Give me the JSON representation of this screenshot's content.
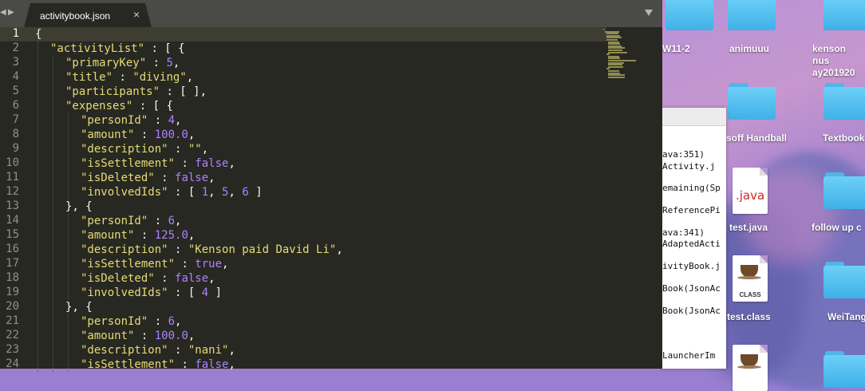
{
  "editor": {
    "tab_title": "activitybook.json",
    "nav_back": "◀",
    "nav_forward": "▶",
    "close_glyph": "×",
    "current_line": 1,
    "lines": [
      {
        "num": "1",
        "indent": 0,
        "t": [
          [
            "p",
            "{"
          ]
        ]
      },
      {
        "num": "2",
        "indent": 1,
        "t": [
          [
            "k",
            "\"activityList\""
          ],
          [
            "p",
            " : [ {"
          ]
        ]
      },
      {
        "num": "3",
        "indent": 2,
        "t": [
          [
            "k",
            "\"primaryKey\""
          ],
          [
            "p",
            " : "
          ],
          [
            "n",
            "5"
          ],
          [
            "p",
            ","
          ]
        ]
      },
      {
        "num": "4",
        "indent": 2,
        "t": [
          [
            "k",
            "\"title\""
          ],
          [
            "p",
            " : "
          ],
          [
            "k",
            "\"diving\""
          ],
          [
            "p",
            ","
          ]
        ]
      },
      {
        "num": "5",
        "indent": 2,
        "t": [
          [
            "k",
            "\"participants\""
          ],
          [
            "p",
            " : [ ],"
          ]
        ]
      },
      {
        "num": "6",
        "indent": 2,
        "t": [
          [
            "k",
            "\"expenses\""
          ],
          [
            "p",
            " : [ {"
          ]
        ]
      },
      {
        "num": "7",
        "indent": 3,
        "t": [
          [
            "k",
            "\"personId\""
          ],
          [
            "p",
            " : "
          ],
          [
            "n",
            "4"
          ],
          [
            "p",
            ","
          ]
        ]
      },
      {
        "num": "8",
        "indent": 3,
        "t": [
          [
            "k",
            "\"amount\""
          ],
          [
            "p",
            " : "
          ],
          [
            "n",
            "100.0"
          ],
          [
            "p",
            ","
          ]
        ]
      },
      {
        "num": "9",
        "indent": 3,
        "t": [
          [
            "k",
            "\"description\""
          ],
          [
            "p",
            " : "
          ],
          [
            "k",
            "\"\""
          ],
          [
            "p",
            ","
          ]
        ]
      },
      {
        "num": "10",
        "indent": 3,
        "t": [
          [
            "k",
            "\"isSettlement\""
          ],
          [
            "p",
            " : "
          ],
          [
            "n",
            "false"
          ],
          [
            "p",
            ","
          ]
        ]
      },
      {
        "num": "11",
        "indent": 3,
        "t": [
          [
            "k",
            "\"isDeleted\""
          ],
          [
            "p",
            " : "
          ],
          [
            "n",
            "false"
          ],
          [
            "p",
            ","
          ]
        ]
      },
      {
        "num": "12",
        "indent": 3,
        "t": [
          [
            "k",
            "\"involvedIds\""
          ],
          [
            "p",
            " : [ "
          ],
          [
            "n",
            "1"
          ],
          [
            "p",
            ", "
          ],
          [
            "n",
            "5"
          ],
          [
            "p",
            ", "
          ],
          [
            "n",
            "6"
          ],
          [
            "p",
            " ]"
          ]
        ]
      },
      {
        "num": "13",
        "indent": 2,
        "t": [
          [
            "p",
            "}, {"
          ]
        ]
      },
      {
        "num": "14",
        "indent": 3,
        "t": [
          [
            "k",
            "\"personId\""
          ],
          [
            "p",
            " : "
          ],
          [
            "n",
            "6"
          ],
          [
            "p",
            ","
          ]
        ]
      },
      {
        "num": "15",
        "indent": 3,
        "t": [
          [
            "k",
            "\"amount\""
          ],
          [
            "p",
            " : "
          ],
          [
            "n",
            "125.0"
          ],
          [
            "p",
            ","
          ]
        ]
      },
      {
        "num": "16",
        "indent": 3,
        "t": [
          [
            "k",
            "\"description\""
          ],
          [
            "p",
            " : "
          ],
          [
            "k",
            "\"Kenson paid David Li\""
          ],
          [
            "p",
            ","
          ]
        ]
      },
      {
        "num": "17",
        "indent": 3,
        "t": [
          [
            "k",
            "\"isSettlement\""
          ],
          [
            "p",
            " : "
          ],
          [
            "n",
            "true"
          ],
          [
            "p",
            ","
          ]
        ]
      },
      {
        "num": "18",
        "indent": 3,
        "t": [
          [
            "k",
            "\"isDeleted\""
          ],
          [
            "p",
            " : "
          ],
          [
            "n",
            "false"
          ],
          [
            "p",
            ","
          ]
        ]
      },
      {
        "num": "19",
        "indent": 3,
        "t": [
          [
            "k",
            "\"involvedIds\""
          ],
          [
            "p",
            " : [ "
          ],
          [
            "n",
            "4"
          ],
          [
            "p",
            " ]"
          ]
        ]
      },
      {
        "num": "20",
        "indent": 2,
        "t": [
          [
            "p",
            "}, {"
          ]
        ]
      },
      {
        "num": "21",
        "indent": 3,
        "t": [
          [
            "k",
            "\"personId\""
          ],
          [
            "p",
            " : "
          ],
          [
            "n",
            "6"
          ],
          [
            "p",
            ","
          ]
        ]
      },
      {
        "num": "22",
        "indent": 3,
        "t": [
          [
            "k",
            "\"amount\""
          ],
          [
            "p",
            " : "
          ],
          [
            "n",
            "100.0"
          ],
          [
            "p",
            ","
          ]
        ]
      },
      {
        "num": "23",
        "indent": 3,
        "t": [
          [
            "k",
            "\"description\""
          ],
          [
            "p",
            " : "
          ],
          [
            "k",
            "\"nani\""
          ],
          [
            "p",
            ","
          ]
        ]
      },
      {
        "num": "24",
        "indent": 3,
        "t": [
          [
            "k",
            "\"isSettlement\""
          ],
          [
            "p",
            " : "
          ],
          [
            "n",
            "false"
          ],
          [
            "p",
            ","
          ]
        ]
      }
    ]
  },
  "console": {
    "lines": [
      "ava:351)",
      "Activity.j",
      "emaining(Sp",
      "ReferencePi",
      "ava:341)",
      "AdaptedActi",
      "ivityBook.j",
      "Book(JsonAc",
      "Book(JsonAc",
      "LauncherIm"
    ]
  },
  "desktop": {
    "items": [
      {
        "label": "W11-2",
        "kind": "folder"
      },
      {
        "label": "animuuu",
        "kind": "folder"
      },
      {
        "label": "kenson nus ay201920",
        "kind": "folder"
      },
      {
        "label": "soff Handball",
        "kind": "folder"
      },
      {
        "label": "Textbook",
        "kind": "folder"
      },
      {
        "label": "test.java",
        "kind": "java",
        "tag": ".java"
      },
      {
        "label": "follow up c",
        "kind": "folder"
      },
      {
        "label": "test.class",
        "kind": "class",
        "tag": "CLASS"
      },
      {
        "label": "WeiTang",
        "kind": "folder"
      }
    ]
  },
  "colors": {
    "editor_bg": "#272822",
    "string": "#e6db74",
    "number": "#ae81ff",
    "plain": "#f8f8f2",
    "folder": "#4fb6ea"
  }
}
